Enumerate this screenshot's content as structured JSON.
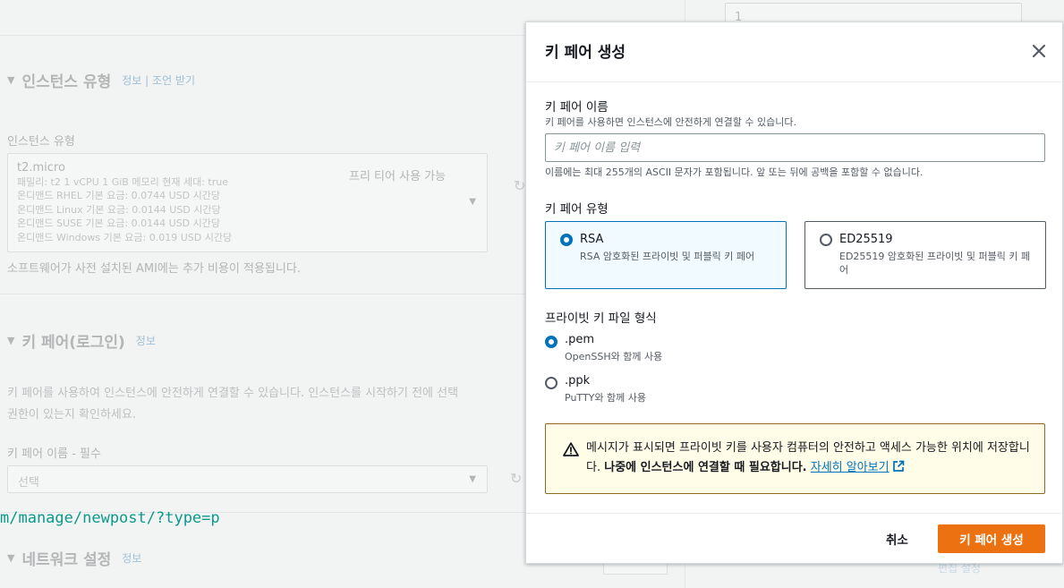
{
  "background": {
    "right_input_value": "1",
    "instance_type_section": {
      "title": "인스턴스 유형",
      "info_link": "정보",
      "separator": "|",
      "advice_link": "조언 받기",
      "field_label": "인스턴스 유형",
      "selected": {
        "name": "t2.micro",
        "free_tier": "프리 티어 사용 가능",
        "family_line": "패밀리: t2    1 vCPU    1 GiB 메모리    현재 세대: true",
        "lines": [
          "온디맨드 RHEL 기본 요금: 0.0744 USD 시간당",
          "온디맨드 Linux 기본 요금: 0.0144 USD 시간당",
          "온디맨드 SUSE 기본 요금: 0.0144 USD 시간당",
          "온디맨드 Windows 기본 요금: 0.019 USD 시간당"
        ]
      },
      "note": "소프트웨어가 사전 설치된 AMI에는 추가 비용이 적용됩니다."
    },
    "key_pair_section": {
      "title": "키 페어(로그인)",
      "info_link": "정보",
      "desc_line1": "키 페어를 사용하여 인스턴스에 안전하게 연결할 수 있습니다. 인스턴스를 시작하기 전에 선택",
      "desc_line2": "권한이 있는지 확인하세요.",
      "field_label": "키 페어 이름 - 필수",
      "select_placeholder": "선택"
    },
    "url_overlay": "m/manage/newpost/?type=p",
    "network_section": {
      "title": "네트워크 설정",
      "info_link": "정보"
    },
    "edit_link": "편집 설정"
  },
  "modal": {
    "title": "키 페어 생성",
    "name_field": {
      "label": "키 페어 이름",
      "description": "키 페어를 사용하면 인스턴스에 안전하게 연결할 수 있습니다.",
      "placeholder": "키 페어 이름 입력",
      "value": "",
      "hint": "이름에는 최대 255개의 ASCII 문자가 포함됩니다. 앞 또는 뒤에 공백을 포함할 수 없습니다."
    },
    "type_field": {
      "label": "키 페어 유형",
      "options": [
        {
          "title": "RSA",
          "description": "RSA 암호화된 프라이빗 및 퍼블릭 키 페어",
          "selected": true
        },
        {
          "title": "ED25519",
          "description": "ED25519 암호화된 프라이빗 및 퍼블릭 키 페어",
          "selected": false
        }
      ]
    },
    "format_field": {
      "label": "프라이빗 키 파일 형식",
      "options": [
        {
          "title": ".pem",
          "description": "OpenSSH와 함께 사용",
          "selected": true
        },
        {
          "title": ".ppk",
          "description": "PuTTY와 함께 사용",
          "selected": false
        }
      ]
    },
    "alert": {
      "text": "메시지가 표시되면 프라이빗 키를 사용자 컴퓨터의 안전하고 액세스 가능한 위치에 저장합니다.",
      "bold_text": "나중에 인스턴스에 연결할 때 필요합니다.",
      "link_text": "자세히 알아보기"
    },
    "cancel_label": "취소",
    "submit_label": "키 페어 생성"
  },
  "colors": {
    "accent_blue": "#0073bb",
    "primary_orange": "#ec7211",
    "warning_border": "#8c6d1f",
    "warning_bg": "#fffce7"
  }
}
